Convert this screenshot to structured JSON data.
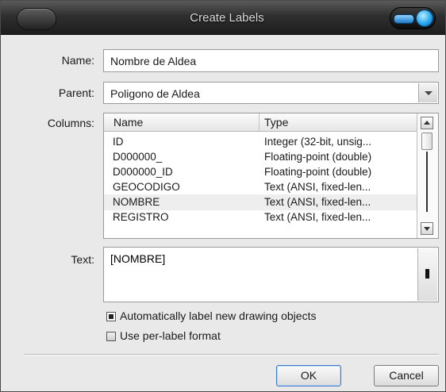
{
  "window": {
    "title": "Create Labels"
  },
  "form": {
    "name_label": "Name:",
    "name_value": "Nombre de Aldea",
    "parent_label": "Parent:",
    "parent_value": "Poligono de Aldea",
    "columns_label": "Columns:",
    "columns": {
      "headers": [
        "Name",
        "Type"
      ],
      "rows": [
        {
          "name": "ID",
          "type": "Integer (32-bit, unsig..."
        },
        {
          "name": "D000000_",
          "type": "Floating-point (double)"
        },
        {
          "name": "D000000_ID",
          "type": "Floating-point (double)"
        },
        {
          "name": "GEOCODIGO",
          "type": "Text (ANSI, fixed-len..."
        },
        {
          "name": "NOMBRE",
          "type": "Text (ANSI, fixed-len..."
        },
        {
          "name": "REGISTRO",
          "type": "Text (ANSI, fixed-len..."
        }
      ],
      "selected_row": "NOMBRE"
    },
    "text_label": "Text:",
    "text_value": "[NOMBRE]",
    "auto_label": {
      "label": "Automatically label new drawing objects",
      "checked": true
    },
    "per_label_format": {
      "label": "Use per-label format",
      "checked": false
    }
  },
  "buttons": {
    "ok": "OK",
    "cancel": "Cancel"
  },
  "colors": {
    "accent": "#27a7ee",
    "titlebar": "#2f2f2f"
  }
}
